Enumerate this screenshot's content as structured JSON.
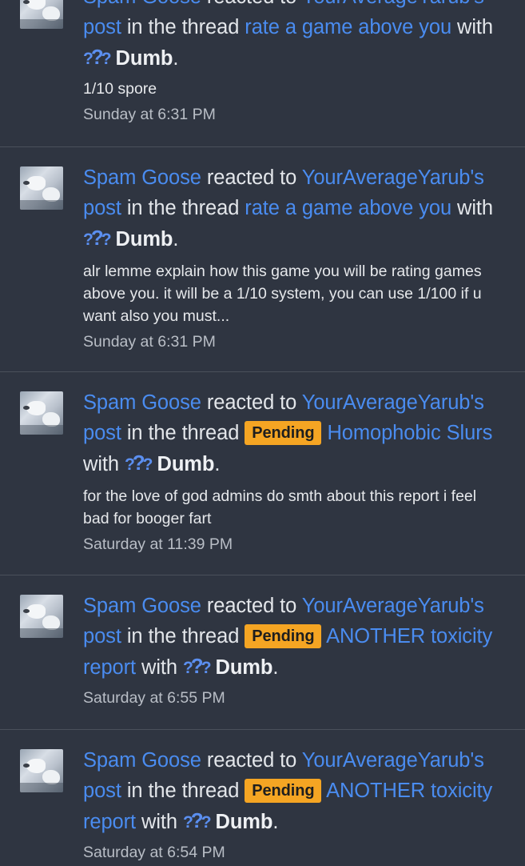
{
  "notifications": [
    {
      "user": "Spam Goose",
      "action": "reacted to",
      "target_user": "YourAverageYarub's",
      "post_word": "post",
      "in_thread": "in the thread",
      "prefix": "",
      "thread": "rate a game above you",
      "with": "with",
      "reaction_icon": "question-marks-icon",
      "reaction": "Dumb",
      "period": ".",
      "snippet": "1/10 spore",
      "time": "Sunday at 6:31 PM"
    },
    {
      "user": "Spam Goose",
      "action": "reacted to",
      "target_user": "YourAverageYarub's",
      "post_word": "post",
      "in_thread": "in the thread",
      "prefix": "",
      "thread": "rate a game above you",
      "with": "with",
      "reaction_icon": "question-marks-icon",
      "reaction": "Dumb",
      "period": ".",
      "snippet": "alr lemme explain how this game you will be rating games above you. it will be a 1/10 system, you can use 1/100 if u want also you must...",
      "time": "Sunday at 6:31 PM"
    },
    {
      "user": "Spam Goose",
      "action": "reacted to",
      "target_user": "YourAverageYarub's",
      "post_word": "post",
      "in_thread": "in the thread",
      "prefix": "Pending",
      "thread": "Homophobic Slurs",
      "with": "with",
      "reaction_icon": "question-marks-icon",
      "reaction": "Dumb",
      "period": ".",
      "snippet": "for the love of god admins do smth about this report i feel bad for booger fart",
      "time": "Saturday at 11:39 PM"
    },
    {
      "user": "Spam Goose",
      "action": "reacted to",
      "target_user": "YourAverageYarub's",
      "post_word": "post",
      "in_thread": "in the thread",
      "prefix": "Pending",
      "thread": "ANOTHER toxicity report",
      "with": "with",
      "reaction_icon": "question-marks-icon",
      "reaction": "Dumb",
      "period": ".",
      "snippet": "",
      "time": "Saturday at 6:55 PM"
    },
    {
      "user": "Spam Goose",
      "action": "reacted to",
      "target_user": "YourAverageYarub's",
      "post_word": "post",
      "in_thread": "in the thread",
      "prefix": "Pending",
      "thread": "ANOTHER toxicity report",
      "with": "with",
      "reaction_icon": "question-marks-icon",
      "reaction": "Dumb",
      "period": ".",
      "snippet": "",
      "time": "Saturday at 6:54 PM"
    }
  ],
  "colors": {
    "background": "#2f3541",
    "link": "#4a8cf0",
    "pending_badge": "#f5a523",
    "divider": "#4a505b"
  }
}
